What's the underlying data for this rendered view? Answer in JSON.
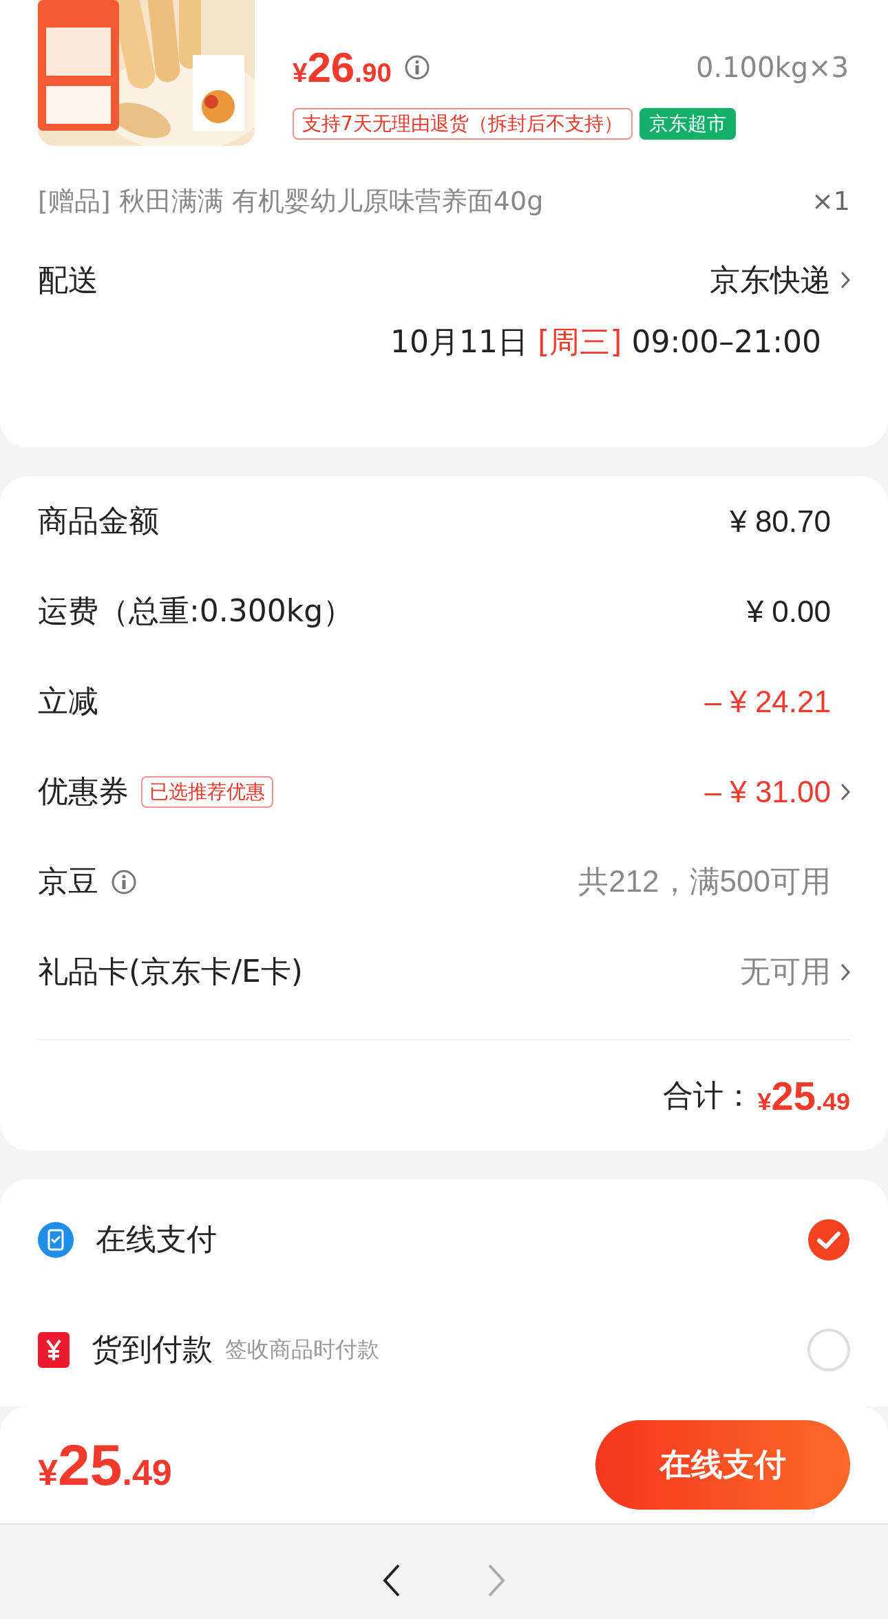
{
  "product": {
    "price": {
      "symbol": "¥",
      "integer": "26",
      "decimal": ".90"
    },
    "weight": "0.100kg×3",
    "tags": [
      {
        "text": "支持7天无理由退货（拆封后不支持）",
        "kind": "outline"
      },
      {
        "text": "京东超市",
        "kind": "store"
      }
    ]
  },
  "gift": {
    "label": "[赠品] 秋田满满 有机婴幼儿原味营养面40g",
    "quantity": "×1"
  },
  "delivery": {
    "label": "配送",
    "carrier": "京东快递",
    "date": "10月11日",
    "weekday": "[周三]",
    "time": "09:00–21:00"
  },
  "summary": {
    "rows": [
      {
        "label": "商品金额",
        "value": "¥ 80.70",
        "kind": "normal"
      },
      {
        "label": "运费（总重:0.300kg）",
        "value": "¥ 0.00",
        "kind": "normal"
      },
      {
        "label": "立减",
        "value": "– ¥ 24.21",
        "kind": "discount"
      },
      {
        "label": "优惠券",
        "badge": "已选推荐优惠",
        "value": "– ¥ 31.00",
        "kind": "discount",
        "chevron": true
      },
      {
        "label": "京豆",
        "info": true,
        "value": "共212，满500可用",
        "kind": "muted"
      },
      {
        "label": "礼品卡(京东卡/E卡)",
        "value": "无可用",
        "kind": "muted",
        "chevron": true
      }
    ],
    "total": {
      "label": "合计：",
      "symbol": "¥",
      "integer": "25",
      "decimal": ".49"
    }
  },
  "payment_methods": [
    {
      "kind": "online",
      "label": "在线支付",
      "selected": true
    },
    {
      "kind": "cod",
      "label": "货到付款",
      "note": "签收商品时付款",
      "selected": false
    }
  ],
  "checkout": {
    "price": {
      "symbol": "¥",
      "integer": "25",
      "decimal": ".49"
    },
    "button": "在线支付"
  },
  "nav": [
    {
      "kind": "back",
      "disabled": false
    },
    {
      "kind": "forward",
      "disabled": true
    }
  ]
}
